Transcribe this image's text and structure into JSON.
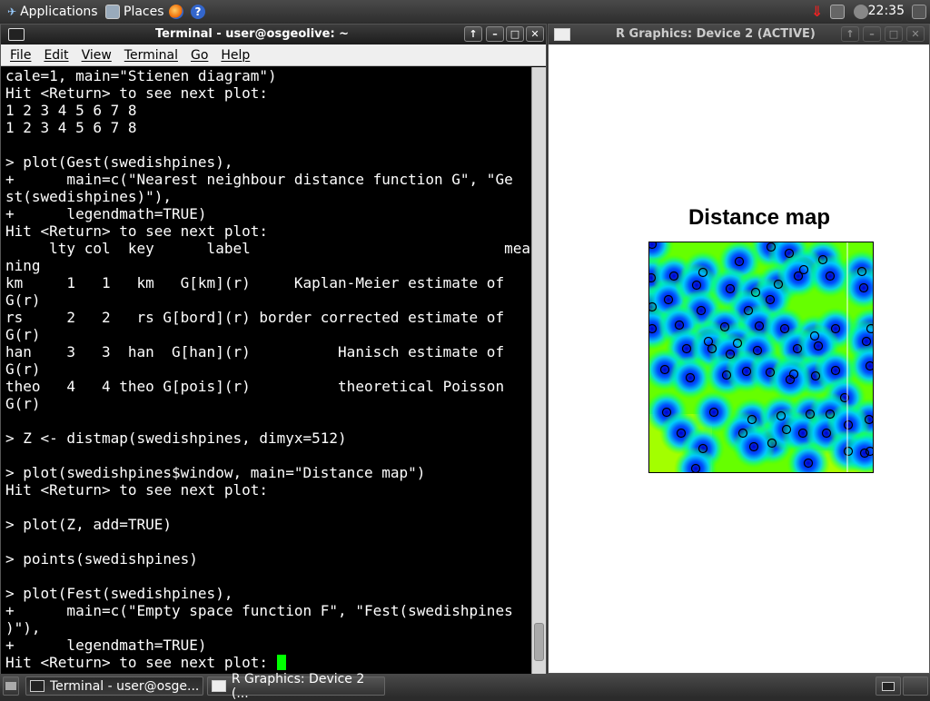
{
  "panel": {
    "applications": "Applications",
    "places": "Places",
    "clock": "22:35"
  },
  "terminal": {
    "title": "Terminal - user@osgeolive: ~",
    "menu": [
      "File",
      "Edit",
      "View",
      "Terminal",
      "Go",
      "Help"
    ],
    "lines": [
      "cale=1, main=\"Stienen diagram\")",
      "Hit <Return> to see next plot:",
      "1 2 3 4 5 6 7 8",
      "1 2 3 4 5 6 7 8",
      "",
      "> plot(Gest(swedishpines),",
      "+      main=c(\"Nearest neighbour distance function G\", \"Ge",
      "st(swedishpines)\"),",
      "+      legendmath=TRUE)",
      "Hit <Return> to see next plot:",
      "     lty col  key      label                             mea",
      "ning",
      "km     1   1   km   G[km](r)     Kaplan-Meier estimate of",
      "G(r)",
      "rs     2   2   rs G[bord](r) border corrected estimate of",
      "G(r)",
      "han    3   3  han  G[han](r)          Hanisch estimate of",
      "G(r)",
      "theo   4   4 theo G[pois](r)          theoretical Poisson",
      "G(r)",
      "",
      "> Z <- distmap(swedishpines, dimyx=512)",
      "",
      "> plot(swedishpines$window, main=\"Distance map\")",
      "Hit <Return> to see next plot:",
      "",
      "> plot(Z, add=TRUE)",
      "",
      "> points(swedishpines)",
      "",
      "> plot(Fest(swedishpines),",
      "+      main=c(\"Empty space function F\", \"Fest(swedishpines",
      ")\"),",
      "+      legendmath=TRUE)",
      "Hit <Return> to see next plot: "
    ]
  },
  "graphics": {
    "title": "R Graphics: Device 2 (ACTIVE)",
    "plot_title": "Distance map"
  },
  "taskbar": {
    "items": [
      "Terminal - user@osge...",
      "R Graphics: Device 2 (..."
    ]
  },
  "colors": {
    "terminal_bg": "#000000",
    "terminal_fg": "#ffffff",
    "cursor": "#00ff00"
  }
}
